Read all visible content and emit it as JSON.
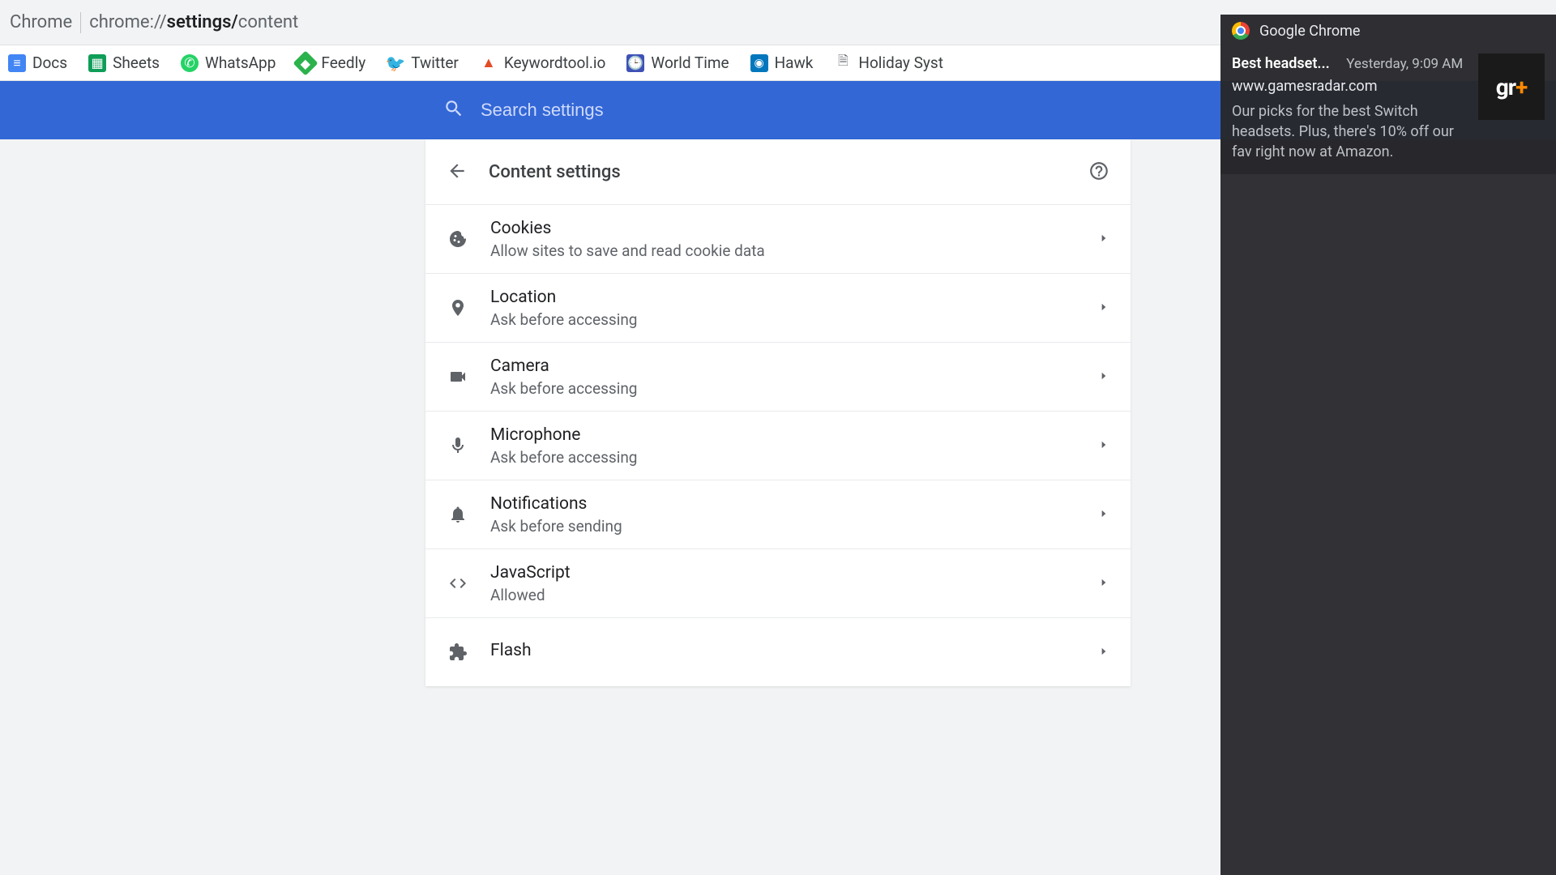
{
  "chrome": {
    "app_label": "Chrome",
    "url_prefix": "chrome://",
    "url_bold": "settings/",
    "url_rest": "content"
  },
  "bookmarks": [
    {
      "label": "Docs"
    },
    {
      "label": "Sheets"
    },
    {
      "label": "WhatsApp"
    },
    {
      "label": "Feedly"
    },
    {
      "label": "Twitter"
    },
    {
      "label": "Keywordtool.io"
    },
    {
      "label": "World Time"
    },
    {
      "label": "Hawk"
    },
    {
      "label": "Holiday Syst"
    }
  ],
  "search": {
    "placeholder": "Search settings"
  },
  "panel": {
    "title": "Content settings"
  },
  "rows": [
    {
      "title": "Cookies",
      "subtitle": "Allow sites to save and read cookie data"
    },
    {
      "title": "Location",
      "subtitle": "Ask before accessing"
    },
    {
      "title": "Camera",
      "subtitle": "Ask before accessing"
    },
    {
      "title": "Microphone",
      "subtitle": "Ask before accessing"
    },
    {
      "title": "Notifications",
      "subtitle": "Ask before sending"
    },
    {
      "title": "JavaScript",
      "subtitle": "Allowed"
    },
    {
      "title": "Flash",
      "subtitle": ""
    }
  ],
  "notification": {
    "app": "Google Chrome",
    "title": "Best headset...",
    "time": "Yesterday, 9:09 AM",
    "site": "www.gamesradar.com",
    "description": "Our picks for the best Switch headsets. Plus, there's 10% off our fav right now at Amazon.",
    "thumb_text_a": "gr",
    "thumb_text_b": "+"
  }
}
